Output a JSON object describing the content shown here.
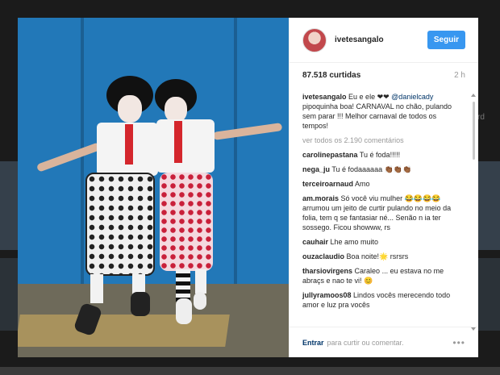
{
  "post": {
    "username": "ivetesangalo",
    "follow_label": "Seguir",
    "likes": "87.518 curtidas",
    "time": "2 h"
  },
  "caption": {
    "author": "ivetesangalo",
    "text_before": "Eu e ele ❤❤",
    "mention": "@danielcady",
    "text_after": "pipoquinha boa! CARNAVAL no chão, pulando sem parar !!! Melhor carnaval de todos os tempos!"
  },
  "view_all": "ver todos os 2.190 comentários",
  "comments": [
    {
      "user": "carolinepastana",
      "text": "Tu é foda!!!!!"
    },
    {
      "user": "nega_ju",
      "text": "Tu é fodaaaaaa 👏🏾👏🏾👏🏾"
    },
    {
      "user": "terceiroarnaud",
      "text": "Amo"
    },
    {
      "user": "am.morais",
      "text": "Só você viu mulher 😂😂😂😂 arrumou um jeito de curtir pulando no meio da folia, tem q se fantasiar né... Senão n ia ter sossego. Ficou showww, rs"
    },
    {
      "user": "cauhair",
      "text": "Lhe amo muito"
    },
    {
      "user": "ouzaclaudio",
      "text": "Boa noite!🌟 rsrsrs"
    },
    {
      "user": "tharsiovirgens",
      "text": "Caraleo ... eu estava no me abraçs e nao te vi! 😊"
    },
    {
      "user": "jullyramoos08",
      "text": "Lindos vocês merecendo todo amor e luz pra vocês"
    }
  ],
  "footer": {
    "login_label": "Entrar",
    "prompt": "para curtir ou comentar.",
    "more_icon": "•••"
  },
  "background": {
    "side_text": "rd"
  }
}
